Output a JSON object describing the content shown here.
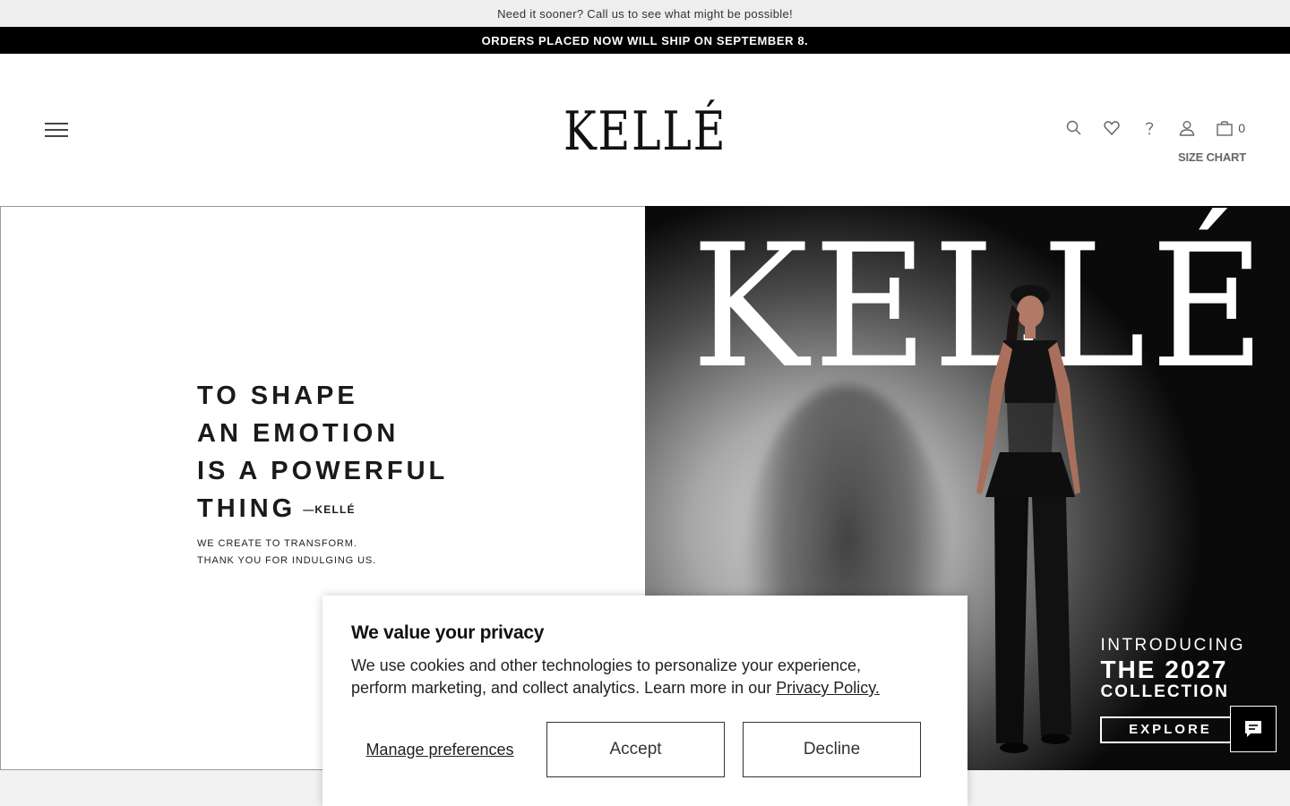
{
  "announcement": {
    "top": "Need it sooner? Call us to see what might be possible!",
    "shipping": "ORDERS PLACED NOW WILL SHIP ON SEPTEMBER 8."
  },
  "header": {
    "logo": "KELLÉ",
    "cart_count": "0",
    "size_chart": "SIZE CHART",
    "icons": [
      "search-icon",
      "heart-icon",
      "help-icon",
      "account-icon",
      "shopping-bag-icon"
    ]
  },
  "hero_left": {
    "lines": [
      "TO SHAPE",
      "AN EMOTION",
      "IS A POWERFUL",
      "THING"
    ],
    "signature": "—KELLÉ",
    "subtext": [
      "WE CREATE TO TRANSFORM.",
      "THANK YOU FOR INDULGING US."
    ]
  },
  "hero_right": {
    "brand": "KELLÉ",
    "intro_line1": "INTRODUCING",
    "intro_line2": "THE 2027",
    "intro_line3": "COLLECTION",
    "cta": "EXPLORE"
  },
  "consent": {
    "title": "We value your privacy",
    "text": "We use cookies and other technologies to personalize your experience, perform marketing, and collect analytics. Learn more in our ",
    "link": "Privacy Policy.",
    "manage": "Manage preferences",
    "accept": "Accept",
    "decline": "Decline"
  },
  "colors": {
    "background": "#ffffff",
    "bar_dark": "#000000",
    "bar_light": "#eeeeee",
    "text": "#222222"
  }
}
